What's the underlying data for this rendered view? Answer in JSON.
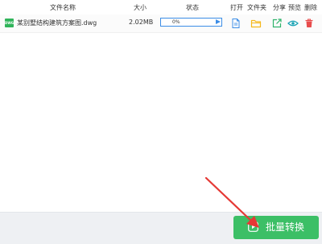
{
  "header": {
    "name": "文件名称",
    "size": "大小",
    "status": "状态",
    "open": "打开",
    "folder": "文件夹",
    "share": "分享",
    "preview": "预览",
    "delete": "删除"
  },
  "file": {
    "icon_label": "DWG",
    "name": "某别墅结构建筑方案图.dwg",
    "size": "2.02MB",
    "progress_text": "0%",
    "progress": 0
  },
  "actions": {
    "open_icon": "document-icon",
    "folder_icon": "folder-icon",
    "share_icon": "share-icon",
    "preview_icon": "eye-icon",
    "delete_icon": "trash-icon"
  },
  "footer": {
    "convert_label": "批量转换"
  },
  "colors": {
    "accent_blue": "#3c8de6",
    "folder_yellow": "#f5b81c",
    "share_green": "#2fb36b",
    "preview_teal": "#1aa3b5",
    "delete_red": "#e84c4c",
    "button_green": "#3cbf66",
    "arrow_red": "#e53935"
  }
}
